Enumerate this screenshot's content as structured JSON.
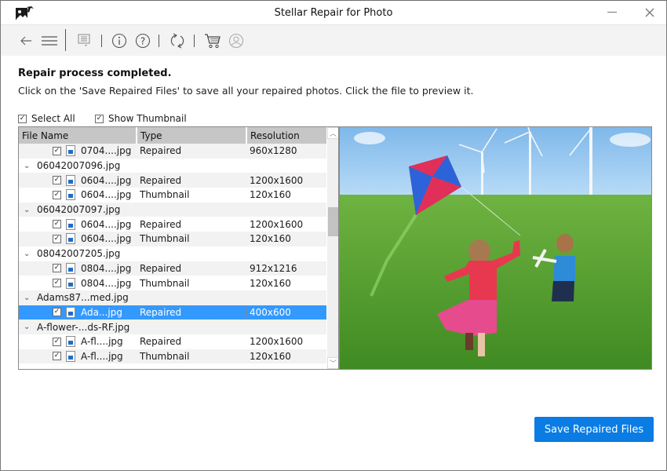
{
  "window": {
    "title": "Stellar Repair for Photo",
    "logo_icon": "stellar-photo-repair-logo",
    "controls": {
      "minimize_icon": "minimize-icon",
      "close_icon": "close-icon"
    }
  },
  "toolbar": {
    "icons": [
      "back-arrow-icon",
      "menu-icon",
      "save-report-icon",
      "info-icon",
      "help-icon",
      "refresh-icon",
      "cart-icon",
      "user-icon"
    ]
  },
  "status": {
    "heading": "Repair process completed.",
    "instruction": "Click on the 'Save Repaired Files' to save all your repaired photos. Click the file to preview it."
  },
  "options": {
    "select_all": {
      "label": "Select All",
      "checked": true
    },
    "show_thumbnail": {
      "label": "Show Thumbnail",
      "checked": true
    }
  },
  "file_list": {
    "columns": [
      "File Name",
      "Type",
      "Resolution"
    ],
    "rows": [
      {
        "kind": "child",
        "name": "0704....jpg",
        "type": "Repaired",
        "resolution": "960x1280",
        "checked": true,
        "alt": true
      },
      {
        "kind": "group",
        "name": "06042007096.jpg",
        "alt": false
      },
      {
        "kind": "child",
        "name": "0604....jpg",
        "type": "Repaired",
        "resolution": "1200x1600",
        "checked": true,
        "alt": true
      },
      {
        "kind": "child",
        "name": "0604....jpg",
        "type": "Thumbnail",
        "resolution": "120x160",
        "checked": true,
        "alt": false
      },
      {
        "kind": "group",
        "name": "06042007097.jpg",
        "alt": true
      },
      {
        "kind": "child",
        "name": "0604....jpg",
        "type": "Repaired",
        "resolution": "1200x1600",
        "checked": true,
        "alt": false
      },
      {
        "kind": "child",
        "name": "0604....jpg",
        "type": "Thumbnail",
        "resolution": "120x160",
        "checked": true,
        "alt": true
      },
      {
        "kind": "group",
        "name": "08042007205.jpg",
        "alt": false
      },
      {
        "kind": "child",
        "name": "0804....jpg",
        "type": "Repaired",
        "resolution": "912x1216",
        "checked": true,
        "alt": true
      },
      {
        "kind": "child",
        "name": "0804....jpg",
        "type": "Thumbnail",
        "resolution": "120x160",
        "checked": true,
        "alt": false
      },
      {
        "kind": "group",
        "name": "Adams87...med.jpg",
        "alt": true
      },
      {
        "kind": "child",
        "name": "Ada...jpg",
        "type": "Repaired",
        "resolution": "400x600",
        "checked": true,
        "selected": true
      },
      {
        "kind": "group",
        "name": "A-flower-...ds-RF.jpg",
        "alt": true
      },
      {
        "kind": "child",
        "name": "A-fl....jpg",
        "type": "Repaired",
        "resolution": "1200x1600",
        "checked": true,
        "alt": false
      },
      {
        "kind": "child",
        "name": "A-fl....jpg",
        "type": "Thumbnail",
        "resolution": "120x160",
        "checked": true,
        "alt": true
      }
    ]
  },
  "preview": {
    "description": "Girl in red flying a kite and boy with toy plane running on green grass hill with wind turbines",
    "colors": {
      "sky": "#8ec3ee",
      "grass": "#4c9a2a"
    }
  },
  "actions": {
    "save_label": "Save Repaired Files",
    "accent": "#0a7ce3"
  }
}
